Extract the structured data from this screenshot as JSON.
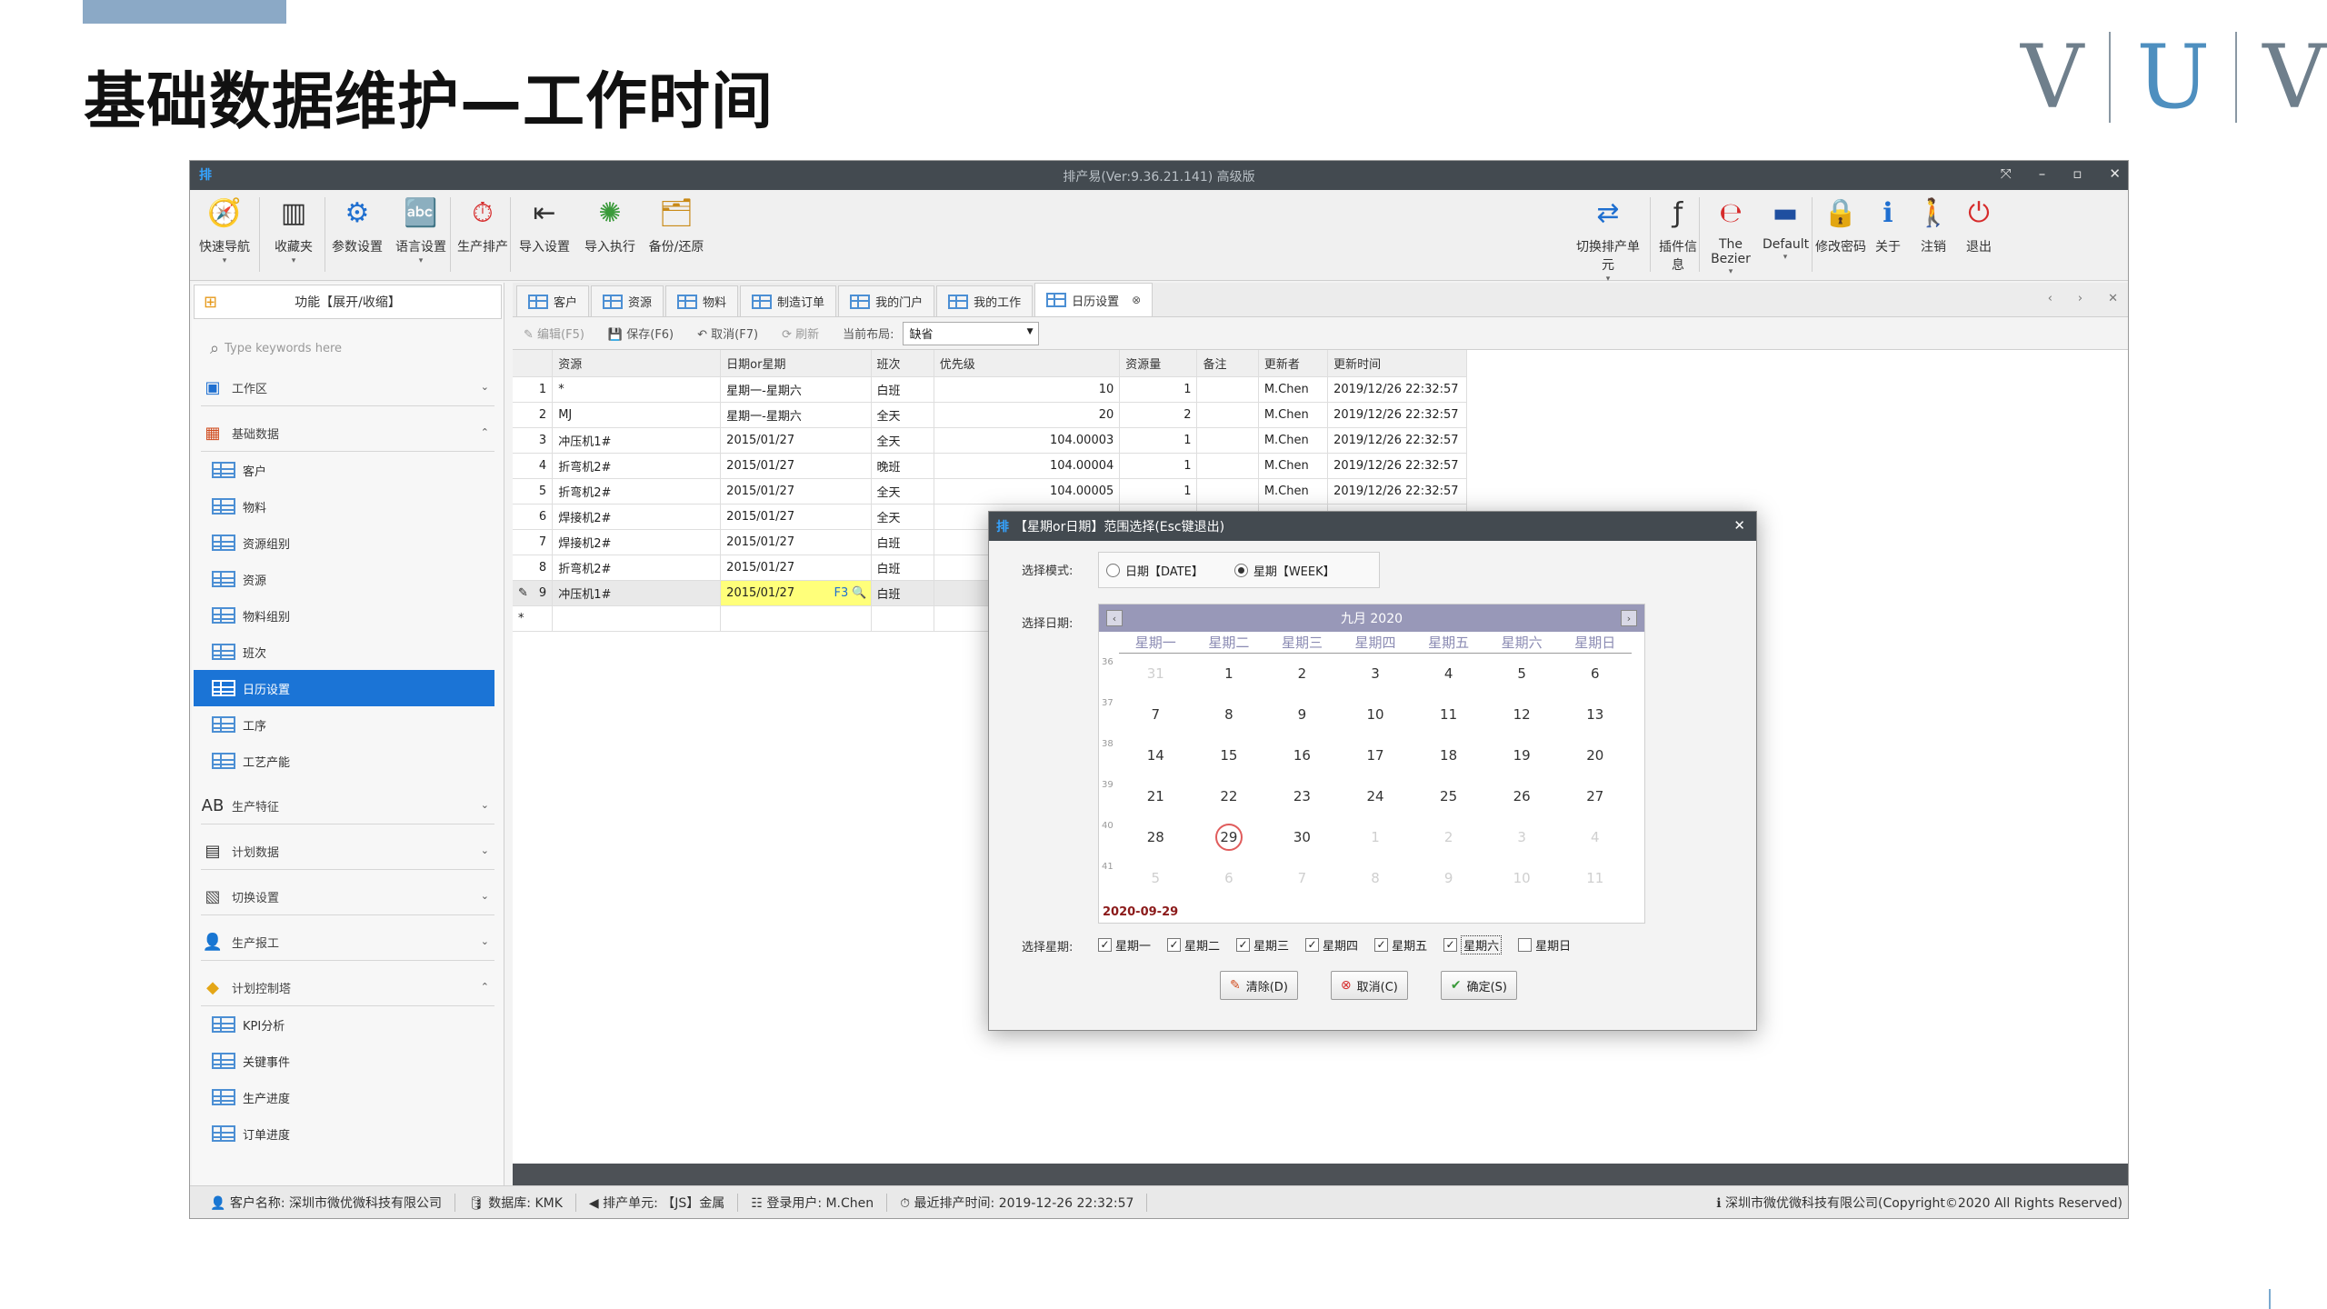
{
  "slide": {
    "title": "基础数据维护—工作时间",
    "logo": [
      "V",
      "U",
      "V"
    ]
  },
  "window": {
    "title": "排产易(Ver:9.36.21.141) 高级版",
    "controls": [
      "⤧",
      "–",
      "▫",
      "✕"
    ]
  },
  "ribbon": {
    "left": [
      {
        "label": "快速导航",
        "icon": "compass-icon",
        "glyph": "🧭",
        "caret": true
      },
      {
        "label": "收藏夹",
        "icon": "favorites-icon",
        "glyph": "▥",
        "caret": true
      },
      {
        "label": "参数设置",
        "icon": "gear-icon",
        "glyph": "⚙",
        "caret": false
      },
      {
        "label": "语言设置",
        "icon": "language-icon",
        "glyph": "🔤",
        "caret": true
      },
      {
        "label": "生产排产",
        "icon": "clock-icon",
        "glyph": "⏱",
        "caret": false
      },
      {
        "label": "导入设置",
        "icon": "import-settings-icon",
        "glyph": "⇤",
        "caret": false
      },
      {
        "label": "导入执行",
        "icon": "import-run-icon",
        "glyph": "✺",
        "caret": false
      },
      {
        "label": "备份/还原",
        "icon": "backup-icon",
        "glyph": "🗂",
        "caret": false
      }
    ],
    "right": [
      {
        "label": "切换排产单元",
        "icon": "switch-unit-icon",
        "glyph": "⇄",
        "caret": true
      },
      {
        "label": "插件信息",
        "icon": "plugin-icon",
        "glyph": "ƒ",
        "caret": false
      },
      {
        "label": "The Bezier",
        "icon": "bezier-theme-icon",
        "glyph": "℮",
        "caret": true
      },
      {
        "label": "Default",
        "icon": "default-theme-icon",
        "glyph": "▬",
        "caret": true
      },
      {
        "label": "修改密码",
        "icon": "lock-icon",
        "glyph": "🔒",
        "caret": false
      },
      {
        "label": "关于",
        "icon": "info-icon",
        "glyph": "ℹ",
        "caret": false
      },
      {
        "label": "注销",
        "icon": "logout-icon",
        "glyph": "🚶",
        "caret": false
      },
      {
        "label": "退出",
        "icon": "power-icon",
        "glyph": "⏻",
        "caret": false
      }
    ]
  },
  "sidebar": {
    "header": "功能【展开/收缩】",
    "search_placeholder": "Type keywords here",
    "groups": [
      {
        "label": "工作区",
        "icon": "workspace-icon",
        "glyph": "▣",
        "chevron": "⌄",
        "items": []
      },
      {
        "label": "基础数据",
        "icon": "basic-data-icon",
        "glyph": "▦",
        "chevron": "⌃",
        "items": [
          "客户",
          "物料",
          "资源组别",
          "资源",
          "物料组别",
          "班次",
          "日历设置",
          "工序",
          "工艺产能"
        ]
      },
      {
        "label": "生产特征",
        "icon": "feature-icon",
        "glyph": "AB",
        "chevron": "⌄",
        "items": []
      },
      {
        "label": "计划数据",
        "icon": "plan-data-icon",
        "glyph": "▤",
        "chevron": "⌄",
        "items": []
      },
      {
        "label": "切换设置",
        "icon": "switch-settings-icon",
        "glyph": "▧",
        "chevron": "⌄",
        "items": []
      },
      {
        "label": "生产报工",
        "icon": "report-icon",
        "glyph": "👤",
        "chevron": "⌄",
        "items": []
      },
      {
        "label": "计划控制塔",
        "icon": "control-tower-icon",
        "glyph": "◆",
        "chevron": "⌃",
        "items": [
          "KPI分析",
          "关键事件",
          "生产进度",
          "订单进度"
        ]
      }
    ],
    "active_item": "日历设置"
  },
  "tabs": [
    {
      "label": "客户",
      "active": false
    },
    {
      "label": "资源",
      "active": false
    },
    {
      "label": "物料",
      "active": false
    },
    {
      "label": "制造订单",
      "active": false
    },
    {
      "label": "我的门户",
      "active": false
    },
    {
      "label": "我的工作",
      "active": false
    },
    {
      "label": "日历设置",
      "active": true
    }
  ],
  "tab_nav": [
    "‹",
    "›",
    "✕"
  ],
  "toolbar": {
    "edit": "✎ 编辑(F5)",
    "save": "💾 保存(F6)",
    "cancel": "↶ 取消(F7)",
    "refresh": "⟳ 刷新",
    "layout_label": "当前布局:",
    "layout_value": "缺省"
  },
  "grid": {
    "columns": [
      "",
      "资源",
      "日期or星期",
      "班次",
      "优先级",
      "资源量",
      "备注",
      "更新者",
      "更新时间"
    ],
    "rows": [
      [
        "1",
        "*",
        "星期一-星期六",
        "白班",
        "10",
        "1",
        "",
        "M.Chen",
        "2019/12/26 22:32:57"
      ],
      [
        "2",
        "MJ",
        "星期一-星期六",
        "全天",
        "20",
        "2",
        "",
        "M.Chen",
        "2019/12/26 22:32:57"
      ],
      [
        "3",
        "冲压机1#",
        "2015/01/27",
        "全天",
        "104.00003",
        "1",
        "",
        "M.Chen",
        "2019/12/26 22:32:57"
      ],
      [
        "4",
        "折弯机2#",
        "2015/01/27",
        "晚班",
        "104.00004",
        "1",
        "",
        "M.Chen",
        "2019/12/26 22:32:57"
      ],
      [
        "5",
        "折弯机2#",
        "2015/01/27",
        "全天",
        "104.00005",
        "1",
        "",
        "M.Chen",
        "2019/12/26 22:32:57"
      ],
      [
        "6",
        "焊接机2#",
        "2015/01/27",
        "全天",
        "",
        "",
        "",
        "",
        ""
      ],
      [
        "7",
        "焊接机2#",
        "2015/01/27",
        "白班",
        "",
        "",
        "",
        "",
        ""
      ],
      [
        "8",
        "折弯机2#",
        "2015/01/27",
        "白班",
        "",
        "",
        "",
        "",
        ""
      ],
      [
        "9",
        "冲压机1#",
        "2015/01/27",
        "白班",
        "",
        "",
        "",
        "",
        ""
      ]
    ],
    "editing_hint": "F3 🔍",
    "row_markers": {
      "edit": "✎",
      "new": "*"
    }
  },
  "dialog": {
    "title": "【星期or日期】范围选择(Esc键退出)",
    "close": "✕",
    "mode_label": "选择模式:",
    "mode_date": "日期【DATE】",
    "mode_week": "星期【WEEK】",
    "date_label": "选择日期:",
    "calendar": {
      "month_title": "九月 2020",
      "nav_prev": "‹",
      "nav_next": "›",
      "dow": [
        "星期一",
        "星期二",
        "星期三",
        "星期四",
        "星期五",
        "星期六",
        "星期日"
      ],
      "weeks": [
        "36",
        "37",
        "38",
        "39",
        "40",
        "41"
      ],
      "rows": [
        [
          "31",
          "1",
          "2",
          "3",
          "4",
          "5",
          "6"
        ],
        [
          "7",
          "8",
          "9",
          "10",
          "11",
          "12",
          "13"
        ],
        [
          "14",
          "15",
          "16",
          "17",
          "18",
          "19",
          "20"
        ],
        [
          "21",
          "22",
          "23",
          "24",
          "25",
          "26",
          "27"
        ],
        [
          "28",
          "29",
          "30",
          "1",
          "2",
          "3",
          "4"
        ],
        [
          "5",
          "6",
          "7",
          "8",
          "9",
          "10",
          "11"
        ]
      ],
      "selected_date": "2020-09-29"
    },
    "week_label": "选择星期:",
    "week_checks": [
      {
        "label": "星期一",
        "checked": true
      },
      {
        "label": "星期二",
        "checked": true
      },
      {
        "label": "星期三",
        "checked": true
      },
      {
        "label": "星期四",
        "checked": true
      },
      {
        "label": "星期五",
        "checked": true
      },
      {
        "label": "星期六",
        "checked": true
      },
      {
        "label": "星期日",
        "checked": false
      }
    ],
    "buttons": [
      {
        "label": "清除(D)",
        "icon": "eraser-icon",
        "glyph": "✎"
      },
      {
        "label": "取消(C)",
        "icon": "cancel-icon",
        "glyph": "⊗"
      },
      {
        "label": "确定(S)",
        "icon": "check-icon",
        "glyph": "✔"
      }
    ]
  },
  "statusbar": {
    "customer": "👤 客户名称: 深圳市微优微科技有限公司",
    "database": "🛢 数据库: KMK",
    "unit": "◀ 排产单元: 【JS】金属",
    "user": "☷ 登录用户: M.Chen",
    "last_run": "⏱ 最近排产时间: 2019-12-26 22:32:57",
    "copyright": "ℹ 深圳市微优微科技有限公司(Copyright©2020 All Rights Reserved)"
  }
}
